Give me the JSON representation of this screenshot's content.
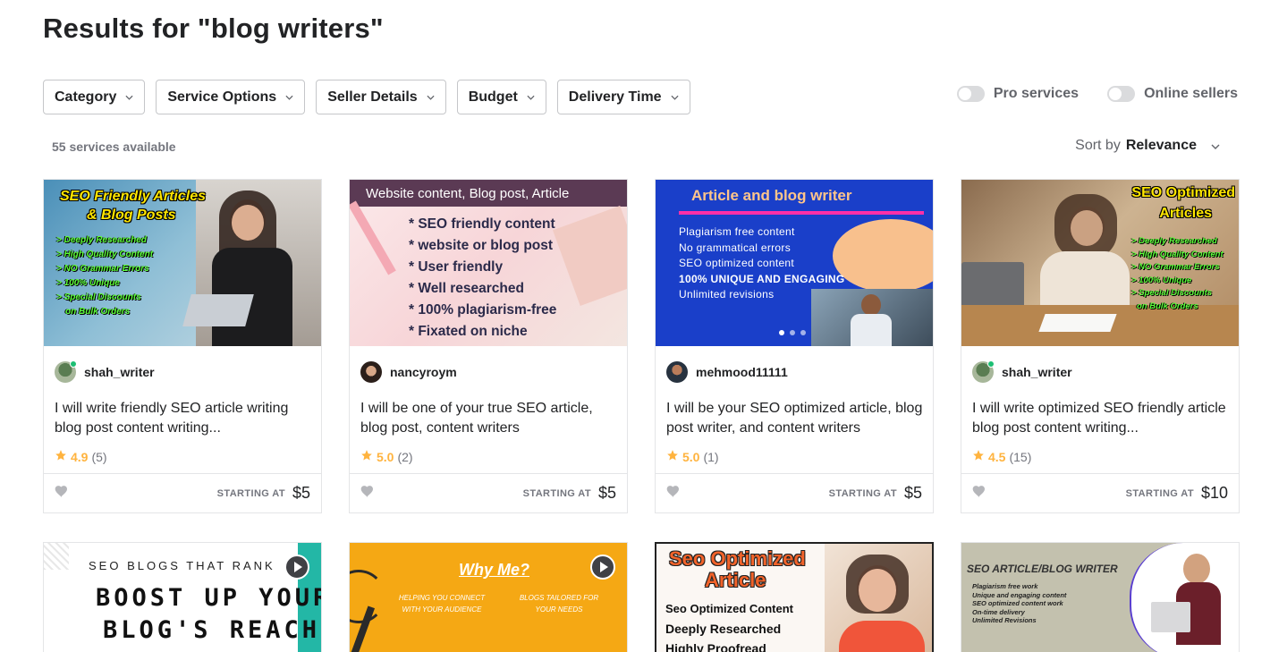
{
  "page": {
    "title": "Results for \"blog writers\""
  },
  "filters": [
    "Category",
    "Service Options",
    "Seller Details",
    "Budget",
    "Delivery Time"
  ],
  "toggles": {
    "pro": "Pro services",
    "online": "Online sellers"
  },
  "results": {
    "count_text": "55 services available",
    "sort_label": "Sort by",
    "sort_value": "Relevance"
  },
  "price_label": "STARTING AT",
  "gigs": [
    {
      "seller": "shah_writer",
      "title": "I will write friendly SEO article writing blog post content writing...",
      "rating": "4.9",
      "reviews": "(5)",
      "price": "$5",
      "thumb": {
        "heading": "SEO Friendly Articles",
        "heading2": "& Blog Posts",
        "lines": [
          "> Deeply Researched",
          "> High Quality Content",
          "> NO Grammar Errors",
          "> 100% Unique",
          "> Special Discounts",
          "on Bulk Orders"
        ]
      }
    },
    {
      "seller": "nancyroym",
      "title": "I will be one of your true SEO article, blog post, content writers",
      "rating": "5.0",
      "reviews": "(2)",
      "price": "$5",
      "thumb": {
        "heading": "Website content, Blog post, Article",
        "lines": [
          "* SEO friendly content",
          "* website or blog post",
          "* User friendly",
          "* Well researched",
          "* 100% plagiarism-free",
          "* Fixated on niche"
        ]
      }
    },
    {
      "seller": "mehmood11111",
      "title": "I will be your SEO optimized article, blog post writer, and content writers",
      "rating": "5.0",
      "reviews": "(1)",
      "price": "$5",
      "thumb": {
        "heading": "Article and blog writer",
        "lines": [
          "Plagiarism free content",
          "No grammatical errors",
          "SEO optimized content",
          "100% UNIQUE AND ENGAGING",
          "Unlimited revisions"
        ]
      }
    },
    {
      "seller": "shah_writer",
      "title": "I will write optimized SEO friendly article blog post content writing...",
      "rating": "4.5",
      "reviews": "(15)",
      "price": "$10",
      "thumb": {
        "heading": "SEO Optimized",
        "heading2": "Articles",
        "lines": [
          "> Deeply Researched",
          "> High Quality Content",
          "> NO Grammar Errors",
          "> 100% Unique",
          "> Special Discounts",
          "on Bulk Orders"
        ]
      }
    }
  ],
  "row2": [
    {
      "small": "SEO BLOGS THAT RANK",
      "big1": "BOOST UP YOUR",
      "big2": "BLOG'S REACH"
    },
    {
      "heading": "Why Me?",
      "left": "HELPING YOU CONNECT WITH YOUR AUDIENCE",
      "right": "BLOGS TAILORED FOR YOUR NEEDS"
    },
    {
      "heading1": "Seo Optimized",
      "heading2": "Article",
      "lines": [
        "Seo Optimized Content",
        "Deeply Researched",
        "Highly Proofread"
      ]
    },
    {
      "heading": "SEO ARTICLE/BLOG WRITER",
      "lines": [
        "Plagiarism free work",
        "Unique and engaging content",
        "SEO optimized content work",
        "On-time delivery",
        "Unlimited Revisions"
      ]
    }
  ],
  "colors": {
    "star": "#ffb33e",
    "online": "#1dbf73",
    "text": "#222325",
    "muted": "#74767e"
  }
}
